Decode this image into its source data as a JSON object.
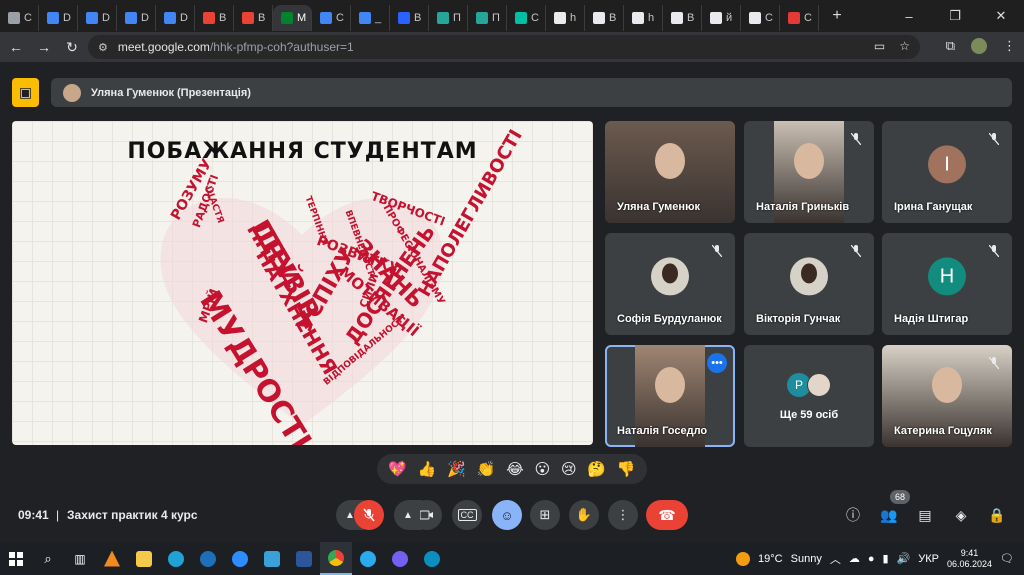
{
  "browser": {
    "tabs": [
      {
        "label": "C",
        "color": "#9aa0a6"
      },
      {
        "label": "D",
        "color": "#4285f4"
      },
      {
        "label": "D",
        "color": "#4285f4"
      },
      {
        "label": "D",
        "color": "#4285f4"
      },
      {
        "label": "D",
        "color": "#4285f4"
      },
      {
        "label": "B",
        "color": "#ea4335"
      },
      {
        "label": "B",
        "color": "#ea4335"
      },
      {
        "label": "M",
        "color": "#00832d",
        "active": true
      },
      {
        "label": "C",
        "color": "#4285f4"
      },
      {
        "label": "_",
        "color": "#4285f4"
      },
      {
        "label": "B",
        "color": "#2962ff"
      },
      {
        "label": "П",
        "color": "#26a69a"
      },
      {
        "label": "П",
        "color": "#26a69a"
      },
      {
        "label": "C",
        "color": "#00bfa5"
      },
      {
        "label": "h",
        "color": "#e8eaed"
      },
      {
        "label": "B",
        "color": "#e8eaed"
      },
      {
        "label": "h",
        "color": "#e8eaed"
      },
      {
        "label": "B",
        "color": "#e8eaed"
      },
      {
        "label": "й",
        "color": "#e8eaed"
      },
      {
        "label": "C",
        "color": "#e8eaed"
      },
      {
        "label": "C",
        "color": "#e53935"
      }
    ],
    "new_tab": "+",
    "url_host": "meet.google.com",
    "url_path": "/hhk-pfmp-coh?authuser=1"
  },
  "meet": {
    "presenter_banner": "Уляна Гуменюк (Презентація)",
    "slide": {
      "title": "ПОБАЖАННЯ СТУДЕНТАМ",
      "words": [
        "ДРУЗІВ",
        "МУДРОСТІ",
        "НАТХНЕННЯ",
        "УСПІХУ",
        "ЗНАНЬ",
        "ТВОРЧОСТІ",
        "РОЗВИТКУ",
        "МОТИВАЦІЇ",
        "ДОСЯГНЕНЬ",
        "НАПОЛЕГЛИВОСТІ",
        "СИЛИ",
        "РОЗУМУ",
        "МРІЙ",
        "РАДОСТІ",
        "ЩАСТЯ",
        "ВПЕВНЕНОСТІ",
        "ВІДПОВІДАЛЬНОСТІ",
        "ПРОФЕСІОНАЛІЗМУ",
        "ТЕРПІННЯ",
        "ІДЕЙ"
      ]
    },
    "participants": [
      {
        "name": "Уляна Гуменюк",
        "type": "video",
        "muted": false
      },
      {
        "name": "Наталія Гриньків",
        "type": "video",
        "muted": true
      },
      {
        "name": "Ірина Ганущак",
        "type": "letter",
        "letter": "I",
        "color": "#a1735f",
        "muted": true
      },
      {
        "name": "Софія Бурдуланюк",
        "type": "photo",
        "muted": true
      },
      {
        "name": "Вікторія Гунчак",
        "type": "photo",
        "muted": true
      },
      {
        "name": "Надія Штигар",
        "type": "letter",
        "letter": "H",
        "color": "#128c7e",
        "muted": true
      },
      {
        "name": "Наталія Госедло",
        "type": "video",
        "active": true,
        "more": "•••"
      },
      {
        "name": "Ще 59 осіб",
        "type": "others",
        "letter": "P"
      },
      {
        "name": "Катерина Гоцуляк",
        "type": "video",
        "muted": true
      }
    ],
    "reactions": [
      "💖",
      "👍",
      "🎉",
      "👏",
      "😂",
      "😮",
      "😢",
      "🤔",
      "👎"
    ],
    "time": "09:41",
    "separator": "|",
    "meeting_title": "Захист практик 4 курс",
    "people_count": "68"
  },
  "taskbar": {
    "weather_temp": "19°C",
    "weather_text": "Sunny",
    "lang": "УКР",
    "clock_time": "9:41",
    "clock_date": "06.06.2024"
  }
}
